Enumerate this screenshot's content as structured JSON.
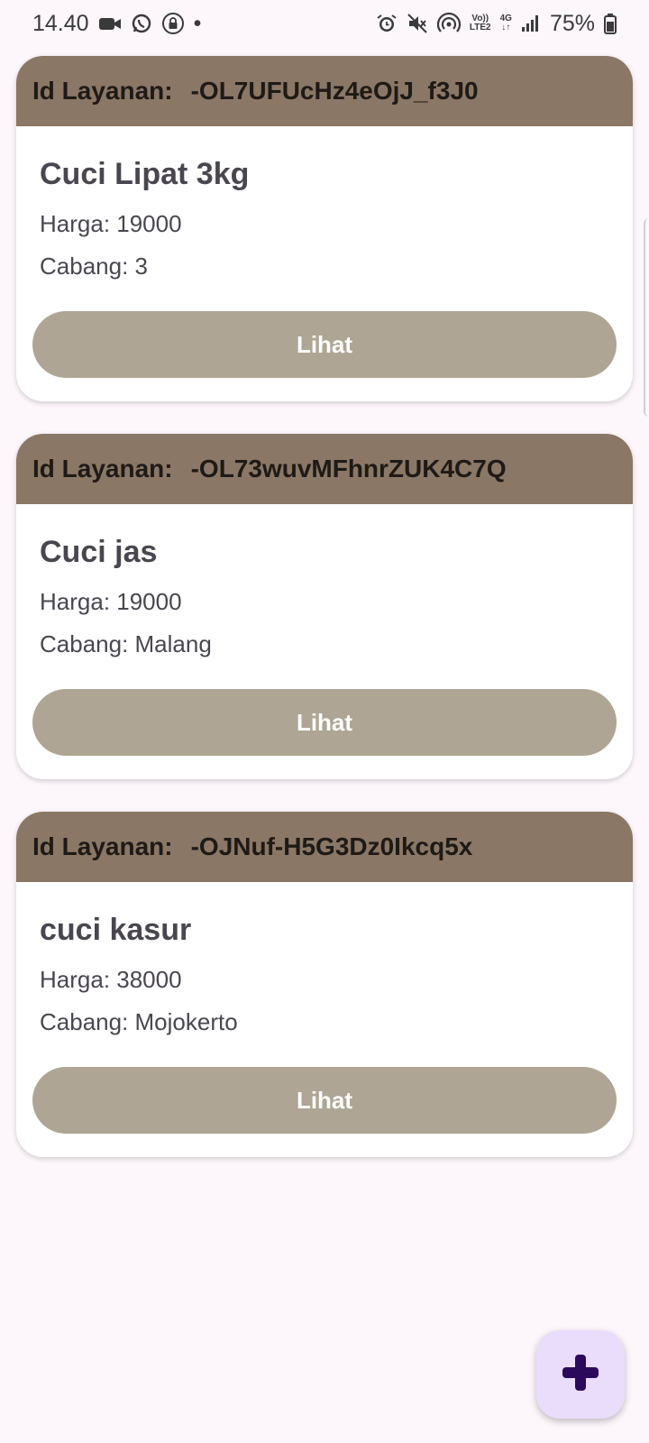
{
  "status_bar": {
    "time": "14.40",
    "dot": "•",
    "volte_top": "Vo))",
    "volte_bottom": "LTE2",
    "network": "4G",
    "battery": "75%"
  },
  "services": [
    {
      "id_label": "Id Layanan:",
      "id": "-OL7UFUcHz4eOjJ_f3J0",
      "name": "Cuci Lipat 3kg",
      "harga": "Harga: 19000",
      "cabang": "Cabang: 3",
      "button": "Lihat"
    },
    {
      "id_label": "Id Layanan:",
      "id": "-OL73wuvMFhnrZUK4C7Q",
      "name": "Cuci jas",
      "harga": "Harga: 19000",
      "cabang": "Cabang: Malang",
      "button": "Lihat"
    },
    {
      "id_label": "Id Layanan:",
      "id": "-OJNuf-H5G3Dz0Ikcq5x",
      "name": "cuci kasur",
      "harga": "Harga: 38000",
      "cabang": "Cabang: Mojokerto",
      "button": "Lihat"
    }
  ],
  "fab": {
    "icon": "plus-icon",
    "color": "#2b0a5c"
  },
  "colors": {
    "header": "#8b7765",
    "button": "#aea594",
    "background": "#fdf7fc",
    "fab_bg": "#eadcfb"
  }
}
